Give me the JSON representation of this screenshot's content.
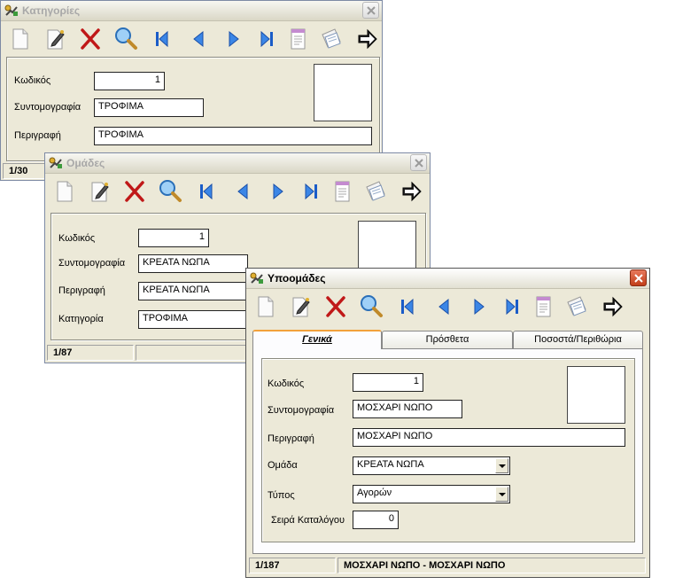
{
  "icons": [
    "new-icon",
    "edit-icon",
    "delete-icon",
    "search-icon",
    "first-icon",
    "previous-icon",
    "next-icon",
    "last-icon",
    "report-icon",
    "copy-icon",
    "exit-icon"
  ],
  "categories": {
    "title": "Κατηγορίες",
    "labels": {
      "code": "Κωδικός",
      "short": "Συντομογραφία",
      "description": "Περιγραφή"
    },
    "values": {
      "code": "1",
      "short": "ΤΡΟΦΙΜΑ",
      "description": "ΤΡΟΦΙΜΑ"
    },
    "status": "1/30"
  },
  "groups": {
    "title": "Ομάδες",
    "labels": {
      "code": "Κωδικός",
      "short": "Συντομογραφία",
      "description": "Περιγραφή",
      "category": "Κατηγορία"
    },
    "values": {
      "code": "1",
      "short": "ΚΡΕΑΤΑ ΝΩΠΑ",
      "description": "ΚΡΕΑΤΑ ΝΩΠΑ",
      "category": "ΤΡΟΦΙΜΑ"
    },
    "status": "1/87"
  },
  "subgroups": {
    "title": "Υποομάδες",
    "tabs": [
      "Γενικά",
      "Πρόσθετα",
      "Ποσοστά/Περιθώρια"
    ],
    "labels": {
      "code": "Κωδικός",
      "short": "Συντομογραφία",
      "description": "Περιγραφή",
      "group": "Ομάδα",
      "type": "Τύπος",
      "order": "Σειρά Καταλόγου"
    },
    "values": {
      "code": "1",
      "short": "ΜΟΣΧΑΡΙ ΝΩΠΟ",
      "description": "ΜΟΣΧΑΡΙ ΝΩΠΟ",
      "group": "ΚΡΕΑΤΑ ΝΩΠΑ",
      "type": "Αγορών",
      "order": "0"
    },
    "status": "1/187",
    "status_text": "ΜΟΣΧΑΡΙ ΝΩΠΟ - ΜΟΣΧΑΡΙ ΝΩΠΟ"
  }
}
